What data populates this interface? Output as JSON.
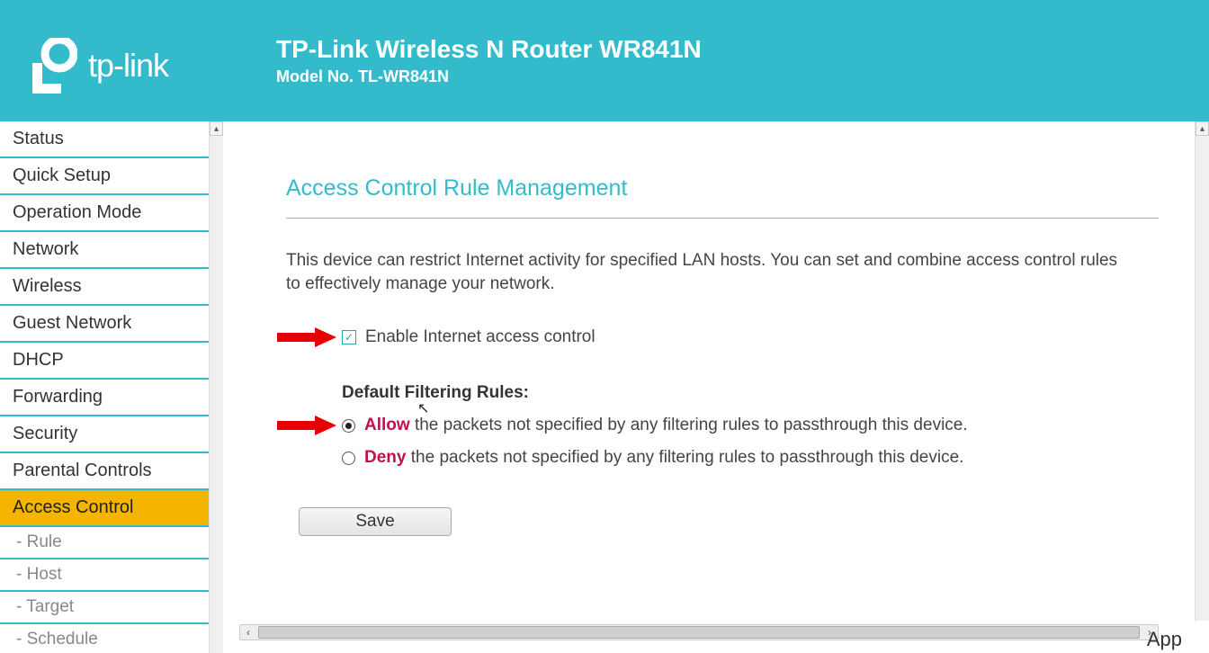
{
  "header": {
    "brand": "tp-link",
    "title": "TP-Link Wireless N Router WR841N",
    "model": "Model No. TL-WR841N"
  },
  "sidebar": {
    "items": [
      {
        "label": "Status"
      },
      {
        "label": "Quick Setup"
      },
      {
        "label": "Operation Mode"
      },
      {
        "label": "Network"
      },
      {
        "label": "Wireless"
      },
      {
        "label": "Guest Network"
      },
      {
        "label": "DHCP"
      },
      {
        "label": "Forwarding"
      },
      {
        "label": "Security"
      },
      {
        "label": "Parental Controls"
      },
      {
        "label": "Access Control",
        "active": true
      },
      {
        "label": "- Rule",
        "sub": true
      },
      {
        "label": "- Host",
        "sub": true
      },
      {
        "label": "- Target",
        "sub": true
      },
      {
        "label": "- Schedule",
        "sub": true
      }
    ]
  },
  "main": {
    "heading": "Access Control Rule Management",
    "desc": "This device can restrict Internet activity for specified LAN hosts. You can set and combine access control rules to effectively manage your network.",
    "enable_label": "Enable Internet access control",
    "enable_checked": true,
    "filter_heading": "Default Filtering Rules",
    "allow_word": "Allow",
    "deny_word": "Deny",
    "rule_tail": " the packets not specified by any filtering rules to passthrough this device.",
    "selected_rule": "allow",
    "save_label": "Save"
  },
  "footer": {
    "text": "App"
  }
}
